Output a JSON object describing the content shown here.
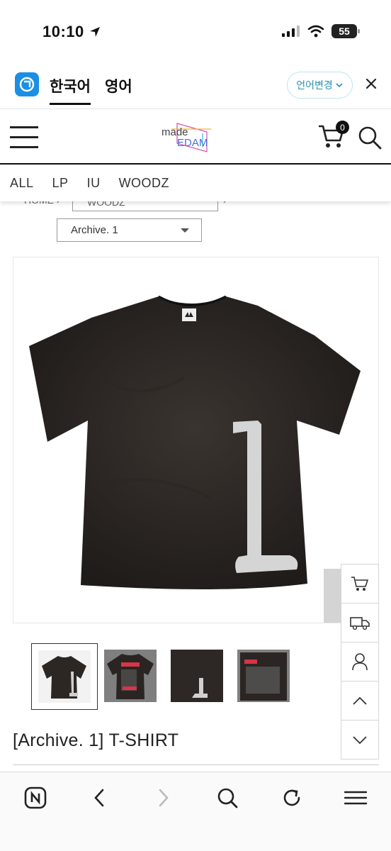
{
  "status": {
    "time": "10:10",
    "battery": "55",
    "icons": [
      "location-arrow-icon",
      "signal-icon",
      "wifi-icon",
      "battery-icon"
    ]
  },
  "translate_bar": {
    "tabs": [
      "한국어",
      "영어"
    ],
    "active_tab": "한국어",
    "change_label": "언어변경",
    "icons": [
      "translate-app-icon",
      "chevron-down-icon",
      "close-icon"
    ],
    "accent": "#1a8fe3"
  },
  "header": {
    "logo_word": "made",
    "logo_brand": "EDAM",
    "cart_count": "0",
    "icons": [
      "menu-icon",
      "cart-icon",
      "search-icon"
    ]
  },
  "category_nav": [
    "ALL",
    "LP",
    "IU",
    "WOODZ"
  ],
  "breadcrumb": {
    "home": "HOME",
    "current": "WOODZ"
  },
  "archive_select": {
    "value": "Archive. 1"
  },
  "product": {
    "title": "[Archive. 1] T-SHIRT",
    "thumbnail_count": 4,
    "selected_thumbnail": 1
  },
  "quick_bar": {
    "icons": [
      "cart-icon",
      "delivery-truck-icon",
      "user-icon",
      "chevron-up-icon",
      "chevron-down-icon"
    ]
  },
  "browser_bar": {
    "icons": [
      "naver-home-icon",
      "back-icon",
      "forward-icon",
      "search-icon",
      "refresh-icon",
      "menu-icon"
    ]
  }
}
